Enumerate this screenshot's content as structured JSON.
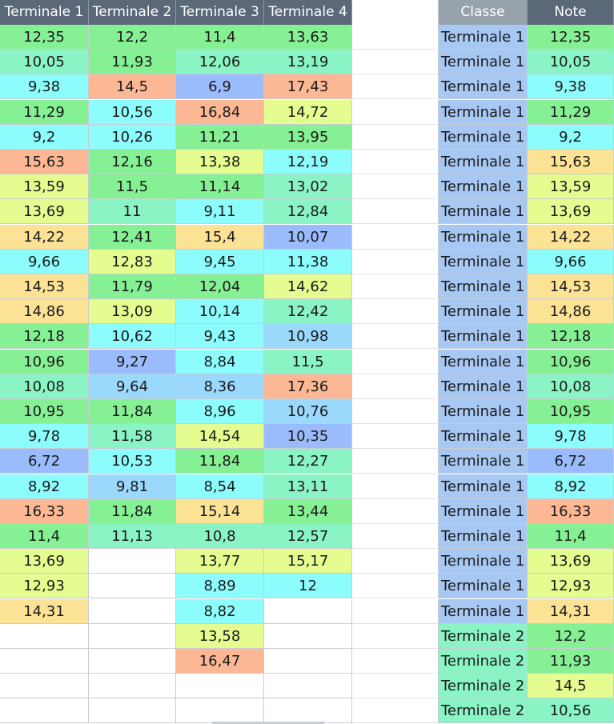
{
  "headers": {
    "left": [
      "Terminale 1",
      "Terminale 2",
      "Terminale 3",
      "Terminale 4"
    ],
    "classe": "Classe",
    "note": "Note"
  },
  "colors": {
    "green": "#86f094",
    "mint": "#8af4c4",
    "cyan": "#8cfcfc",
    "lightblue": "#9ad8fc",
    "blue": "#9abcfc",
    "yellow": "#e4fc90",
    "gold": "#fce294",
    "orange": "#fcb894",
    "white": "#ffffff",
    "classe_bg": "#a8c8f4",
    "header_bg": "#5a6878"
  },
  "columns": [
    [
      {
        "v": "12,35",
        "c": "green"
      },
      {
        "v": "10,05",
        "c": "mint"
      },
      {
        "v": "9,38",
        "c": "cyan"
      },
      {
        "v": "11,29",
        "c": "green"
      },
      {
        "v": "9,2",
        "c": "cyan"
      },
      {
        "v": "15,63",
        "c": "orange"
      },
      {
        "v": "13,59",
        "c": "yellow"
      },
      {
        "v": "13,69",
        "c": "yellow"
      },
      {
        "v": "14,22",
        "c": "gold"
      },
      {
        "v": "9,66",
        "c": "cyan"
      },
      {
        "v": "14,53",
        "c": "gold"
      },
      {
        "v": "14,86",
        "c": "gold"
      },
      {
        "v": "12,18",
        "c": "green"
      },
      {
        "v": "10,96",
        "c": "green"
      },
      {
        "v": "10,08",
        "c": "mint"
      },
      {
        "v": "10,95",
        "c": "green"
      },
      {
        "v": "9,78",
        "c": "cyan"
      },
      {
        "v": "6,72",
        "c": "blue"
      },
      {
        "v": "8,92",
        "c": "cyan"
      },
      {
        "v": "16,33",
        "c": "orange"
      },
      {
        "v": "11,4",
        "c": "green"
      },
      {
        "v": "13,69",
        "c": "yellow"
      },
      {
        "v": "12,93",
        "c": "yellow"
      },
      {
        "v": "14,31",
        "c": "gold"
      },
      {
        "v": "",
        "c": "white"
      },
      {
        "v": "",
        "c": "white"
      },
      {
        "v": "",
        "c": "white"
      },
      {
        "v": "",
        "c": "white"
      }
    ],
    [
      {
        "v": "12,2",
        "c": "green"
      },
      {
        "v": "11,93",
        "c": "green"
      },
      {
        "v": "14,5",
        "c": "orange"
      },
      {
        "v": "10,56",
        "c": "cyan"
      },
      {
        "v": "10,26",
        "c": "cyan"
      },
      {
        "v": "12,16",
        "c": "green"
      },
      {
        "v": "11,5",
        "c": "green"
      },
      {
        "v": "11",
        "c": "mint"
      },
      {
        "v": "12,41",
        "c": "green"
      },
      {
        "v": "12,83",
        "c": "yellow"
      },
      {
        "v": "11,79",
        "c": "green"
      },
      {
        "v": "13,09",
        "c": "yellow"
      },
      {
        "v": "10,62",
        "c": "cyan"
      },
      {
        "v": "9,27",
        "c": "blue"
      },
      {
        "v": "9,64",
        "c": "lightblue"
      },
      {
        "v": "11,84",
        "c": "green"
      },
      {
        "v": "11,58",
        "c": "mint"
      },
      {
        "v": "10,53",
        "c": "cyan"
      },
      {
        "v": "9,81",
        "c": "lightblue"
      },
      {
        "v": "11,84",
        "c": "green"
      },
      {
        "v": "11,13",
        "c": "mint"
      },
      {
        "v": "",
        "c": "white"
      },
      {
        "v": "",
        "c": "white"
      },
      {
        "v": "",
        "c": "white"
      },
      {
        "v": "",
        "c": "white"
      },
      {
        "v": "",
        "c": "white"
      },
      {
        "v": "",
        "c": "white"
      },
      {
        "v": "",
        "c": "white"
      }
    ],
    [
      {
        "v": "11,4",
        "c": "green"
      },
      {
        "v": "12,06",
        "c": "mint"
      },
      {
        "v": "6,9",
        "c": "blue"
      },
      {
        "v": "16,84",
        "c": "orange"
      },
      {
        "v": "11,21",
        "c": "green"
      },
      {
        "v": "13,38",
        "c": "yellow"
      },
      {
        "v": "11,14",
        "c": "green"
      },
      {
        "v": "9,11",
        "c": "cyan"
      },
      {
        "v": "15,4",
        "c": "gold"
      },
      {
        "v": "9,45",
        "c": "cyan"
      },
      {
        "v": "12,04",
        "c": "green"
      },
      {
        "v": "10,14",
        "c": "cyan"
      },
      {
        "v": "9,43",
        "c": "cyan"
      },
      {
        "v": "8,84",
        "c": "cyan"
      },
      {
        "v": "8,36",
        "c": "lightblue"
      },
      {
        "v": "8,96",
        "c": "cyan"
      },
      {
        "v": "14,54",
        "c": "yellow"
      },
      {
        "v": "11,84",
        "c": "green"
      },
      {
        "v": "8,54",
        "c": "cyan"
      },
      {
        "v": "15,14",
        "c": "gold"
      },
      {
        "v": "10,8",
        "c": "mint"
      },
      {
        "v": "13,77",
        "c": "yellow"
      },
      {
        "v": "8,89",
        "c": "cyan"
      },
      {
        "v": "8,82",
        "c": "cyan"
      },
      {
        "v": "13,58",
        "c": "yellow"
      },
      {
        "v": "16,47",
        "c": "orange"
      },
      {
        "v": "",
        "c": "white"
      },
      {
        "v": "",
        "c": "white"
      }
    ],
    [
      {
        "v": "13,63",
        "c": "green"
      },
      {
        "v": "13,19",
        "c": "mint"
      },
      {
        "v": "17,43",
        "c": "orange"
      },
      {
        "v": "14,72",
        "c": "yellow"
      },
      {
        "v": "13,95",
        "c": "green"
      },
      {
        "v": "12,19",
        "c": "cyan"
      },
      {
        "v": "13,02",
        "c": "mint"
      },
      {
        "v": "12,84",
        "c": "mint"
      },
      {
        "v": "10,07",
        "c": "blue"
      },
      {
        "v": "11,38",
        "c": "cyan"
      },
      {
        "v": "14,62",
        "c": "yellow"
      },
      {
        "v": "12,42",
        "c": "mint"
      },
      {
        "v": "10,98",
        "c": "lightblue"
      },
      {
        "v": "11,5",
        "c": "mint"
      },
      {
        "v": "17,36",
        "c": "orange"
      },
      {
        "v": "10,76",
        "c": "lightblue"
      },
      {
        "v": "10,35",
        "c": "blue"
      },
      {
        "v": "12,27",
        "c": "mint"
      },
      {
        "v": "13,11",
        "c": "mint"
      },
      {
        "v": "13,44",
        "c": "green"
      },
      {
        "v": "12,57",
        "c": "mint"
      },
      {
        "v": "15,17",
        "c": "yellow"
      },
      {
        "v": "12",
        "c": "cyan"
      },
      {
        "v": "",
        "c": "white"
      },
      {
        "v": "",
        "c": "white"
      },
      {
        "v": "",
        "c": "white"
      },
      {
        "v": "",
        "c": "white"
      },
      {
        "v": "",
        "c": "white"
      }
    ]
  ],
  "right_rows": [
    {
      "classe": "Terminale 1",
      "note": "12,35",
      "c": "green"
    },
    {
      "classe": "Terminale 1",
      "note": "10,05",
      "c": "mint"
    },
    {
      "classe": "Terminale 1",
      "note": "9,38",
      "c": "cyan"
    },
    {
      "classe": "Terminale 1",
      "note": "11,29",
      "c": "green"
    },
    {
      "classe": "Terminale 1",
      "note": "9,2",
      "c": "cyan"
    },
    {
      "classe": "Terminale 1",
      "note": "15,63",
      "c": "gold"
    },
    {
      "classe": "Terminale 1",
      "note": "13,59",
      "c": "yellow"
    },
    {
      "classe": "Terminale 1",
      "note": "13,69",
      "c": "yellow"
    },
    {
      "classe": "Terminale 1",
      "note": "14,22",
      "c": "gold"
    },
    {
      "classe": "Terminale 1",
      "note": "9,66",
      "c": "cyan"
    },
    {
      "classe": "Terminale 1",
      "note": "14,53",
      "c": "gold"
    },
    {
      "classe": "Terminale 1",
      "note": "14,86",
      "c": "gold"
    },
    {
      "classe": "Terminale 1",
      "note": "12,18",
      "c": "green"
    },
    {
      "classe": "Terminale 1",
      "note": "10,96",
      "c": "green"
    },
    {
      "classe": "Terminale 1",
      "note": "10,08",
      "c": "mint"
    },
    {
      "classe": "Terminale 1",
      "note": "10,95",
      "c": "green"
    },
    {
      "classe": "Terminale 1",
      "note": "9,78",
      "c": "cyan"
    },
    {
      "classe": "Terminale 1",
      "note": "6,72",
      "c": "blue"
    },
    {
      "classe": "Terminale 1",
      "note": "8,92",
      "c": "cyan"
    },
    {
      "classe": "Terminale 1",
      "note": "16,33",
      "c": "orange"
    },
    {
      "classe": "Terminale 1",
      "note": "11,4",
      "c": "green"
    },
    {
      "classe": "Terminale 1",
      "note": "13,69",
      "c": "yellow"
    },
    {
      "classe": "Terminale 1",
      "note": "12,93",
      "c": "yellow"
    },
    {
      "classe": "Terminale 1",
      "note": "14,31",
      "c": "gold"
    },
    {
      "classe": "Terminale 2",
      "note": "12,2",
      "c": "green"
    },
    {
      "classe": "Terminale 2",
      "note": "11,93",
      "c": "green"
    },
    {
      "classe": "Terminale 2",
      "note": "14,5",
      "c": "yellow"
    },
    {
      "classe": "Terminale 2",
      "note": "10,56",
      "c": "mint"
    }
  ]
}
